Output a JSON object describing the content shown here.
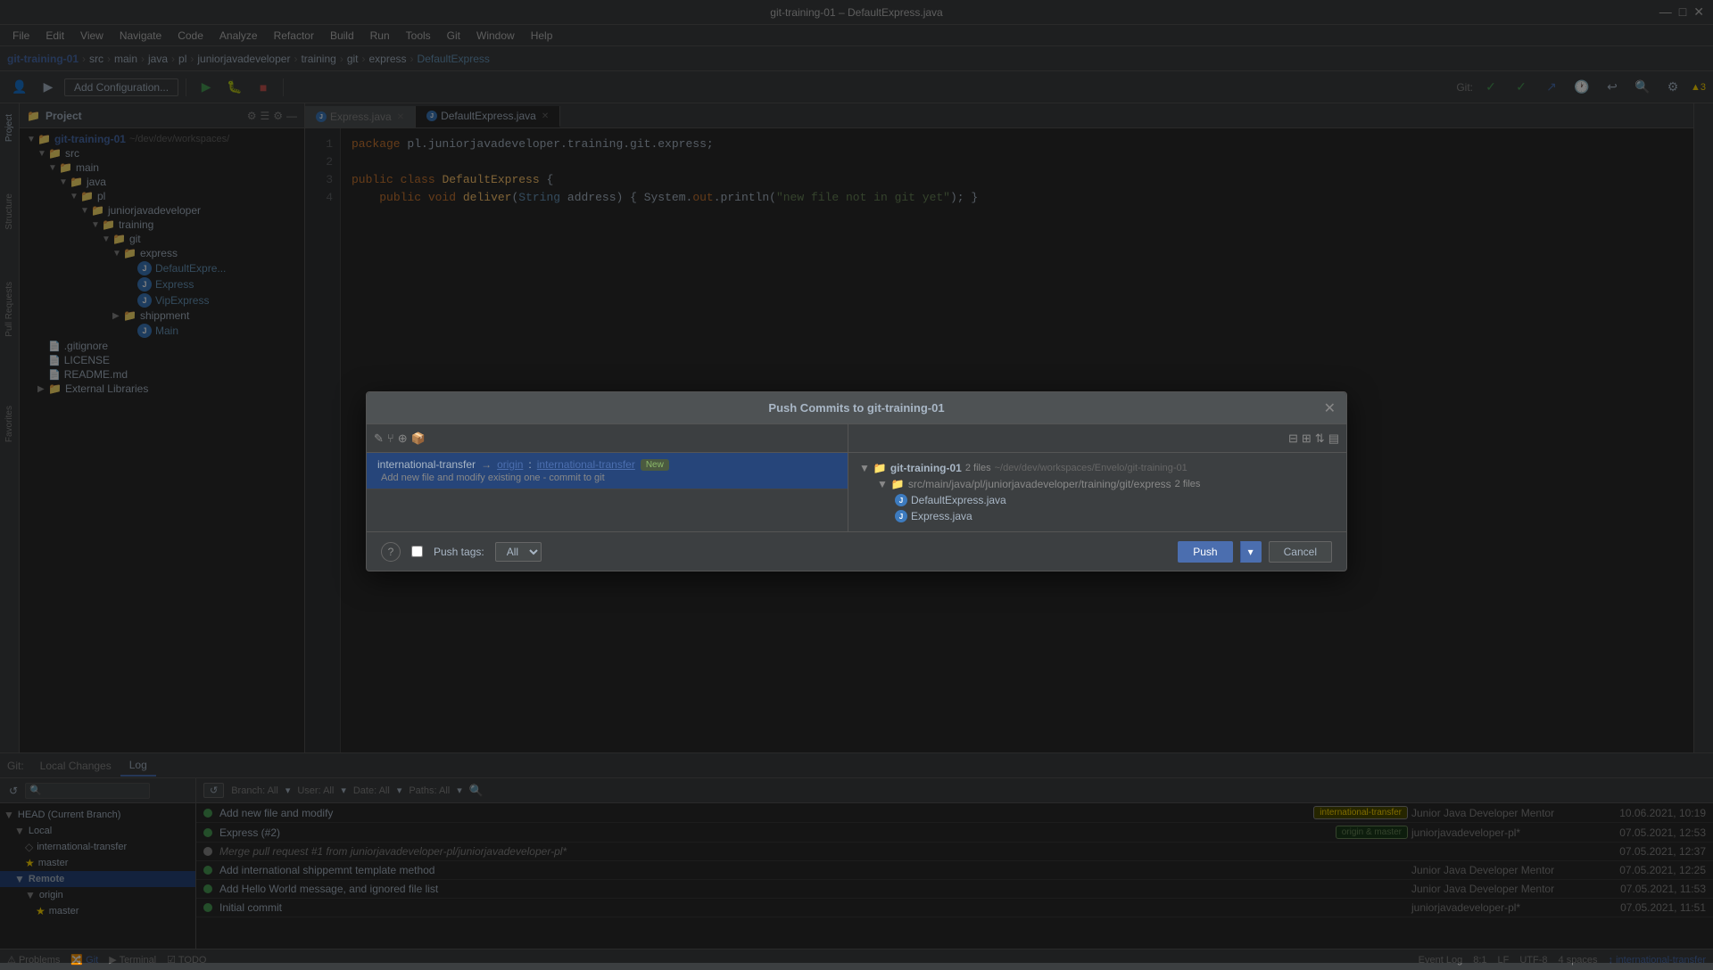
{
  "titleBar": {
    "title": "git-training-01 – DefaultExpress.java",
    "minimize": "—",
    "maximize": "□",
    "close": "✕"
  },
  "menuBar": {
    "items": [
      "File",
      "Edit",
      "View",
      "Navigate",
      "Code",
      "Analyze",
      "Refactor",
      "Build",
      "Run",
      "Tools",
      "Git",
      "Window",
      "Help"
    ]
  },
  "breadcrumb": {
    "items": [
      "git-training-01",
      "src",
      "main",
      "java",
      "pl",
      "juniorjavadeveloper",
      "training",
      "git",
      "express",
      "DefaultExpress"
    ]
  },
  "toolbar": {
    "addConfig": "Add Configuration...",
    "git_label": "Git:",
    "warnings": "▲3"
  },
  "projectPanel": {
    "title": "Project",
    "rootName": "git-training-01",
    "rootPath": "~/dev/dev/workspaces/",
    "tree": [
      {
        "label": "src",
        "type": "folder",
        "indent": 1
      },
      {
        "label": "main",
        "type": "folder",
        "indent": 2
      },
      {
        "label": "java",
        "type": "folder",
        "indent": 3
      },
      {
        "label": "pl",
        "type": "folder",
        "indent": 4
      },
      {
        "label": "juniorjavadeveloper",
        "type": "folder",
        "indent": 5
      },
      {
        "label": "training",
        "type": "folder",
        "indent": 6
      },
      {
        "label": "git",
        "type": "folder",
        "indent": 7
      },
      {
        "label": "express",
        "type": "folder",
        "indent": 8
      },
      {
        "label": "DefaultExpress",
        "type": "java",
        "indent": 9,
        "color": "blue"
      },
      {
        "label": "Express",
        "type": "java",
        "indent": 9,
        "color": "blue"
      },
      {
        "label": "VipExpress",
        "type": "java",
        "indent": 9,
        "color": "blue"
      },
      {
        "label": "shippment",
        "type": "folder",
        "indent": 8
      },
      {
        "label": "Main",
        "type": "java",
        "indent": 9,
        "color": "blue"
      },
      {
        "label": ".gitignore",
        "type": "file",
        "indent": 1
      },
      {
        "label": "LICENSE",
        "type": "file",
        "indent": 1
      },
      {
        "label": "README.md",
        "type": "file",
        "indent": 1
      },
      {
        "label": "External Libraries",
        "type": "folder",
        "indent": 1
      }
    ]
  },
  "editorTabs": [
    {
      "label": "Express.java",
      "active": false
    },
    {
      "label": "DefaultExpress.java",
      "active": true
    }
  ],
  "codeLines": [
    {
      "num": 1,
      "code": "package pl.juniorjavadeveloper.training.git.express;"
    },
    {
      "num": 2,
      "code": ""
    },
    {
      "num": 3,
      "code": "public class DefaultExpress {"
    },
    {
      "num": 4,
      "code": "    public void deliver(String address) { System.out.println(\"new file not in git yet\"); }"
    }
  ],
  "gitPanel": {
    "tabs": [
      "Local Changes",
      "Log"
    ],
    "activeTab": "Log",
    "gitLabel": "Git:",
    "localChangesLabel": "Local Changes",
    "logLabel": "Log",
    "logToolbar": {
      "branch": "Branch: All",
      "user": "User: All",
      "date": "Date: All",
      "paths": "Paths: All"
    },
    "branches": {
      "head": "HEAD (Current Branch)",
      "local": "Local",
      "localItems": [
        "international-transfer",
        "master"
      ],
      "remote": "Remote",
      "remoteItems": [
        "origin",
        "master"
      ]
    },
    "commits": [
      {
        "msg": "Add new file and modify",
        "tag": "international-transfer",
        "tagType": "yellow",
        "author": "Junior Java Developer Mentor",
        "date": "10.06.2021, 10:19",
        "dotColor": "green"
      },
      {
        "msg": "Express (#2)",
        "tag": "origin & master",
        "tagType": "green",
        "author": "juniorjavadeveloper-pl*",
        "date": "07.05.2021, 12:53",
        "dotColor": "green"
      },
      {
        "msg": "Merge pull request #1 from juniorjavadeveloper-pl/juniorjavadeveloper-pl*",
        "tag": "",
        "tagType": "",
        "author": "",
        "date": "07.05.2021, 12:37",
        "dotColor": "gray",
        "italic": true
      },
      {
        "msg": "Add international shippemnt template method",
        "tag": "",
        "tagType": "",
        "author": "Junior Java Developer Mentor",
        "date": "07.05.2021, 12:25",
        "dotColor": "green"
      },
      {
        "msg": "Add Hello World message, and ignored file list",
        "tag": "",
        "tagType": "",
        "author": "Junior Java Developer Mentor",
        "date": "07.05.2021, 11:53",
        "dotColor": "green"
      },
      {
        "msg": "Initial commit",
        "tag": "",
        "tagType": "",
        "author": "juniorjavadeveloper-pl*",
        "date": "07.05.2021, 11:51",
        "dotColor": "green"
      }
    ]
  },
  "modal": {
    "title": "Push Commits to git-training-01",
    "commitItem": {
      "branch": "international-transfer",
      "arrow": "→",
      "remote": "origin",
      "colon": " : ",
      "ref": "international-transfer",
      "badge": "New"
    },
    "commitMsg": "Add new file and modify existing one - commit to git",
    "rightPanel": {
      "repoName": "git-training-01",
      "repoFiles": "2 files",
      "repoPath": "~/dev/dev/workspaces/Envelo/git-training-01",
      "subPath": "src/main/java/pl/juniorjavadeveloper/training/git/express",
      "subFiles": "2 files",
      "files": [
        "DefaultExpress.java",
        "Express.java"
      ]
    },
    "footer": {
      "helpLabel": "?",
      "pushTagsLabel": "Push tags:",
      "pushTagsCheckbox": false,
      "pushTagsValue": "All",
      "pushButton": "Push",
      "cancelButton": "Cancel"
    }
  },
  "statusBar": {
    "problems": "Problems",
    "git": "Git",
    "terminal": "Terminal",
    "todo": "TODO",
    "eventLog": "Event Log",
    "position": "8:1",
    "lineEnding": "LF",
    "encoding": "UTF-8",
    "indent": "4 spaces",
    "branch": "↕ international-transfer"
  }
}
